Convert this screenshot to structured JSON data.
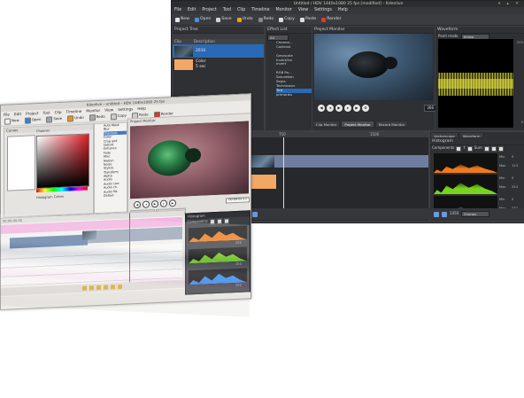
{
  "dark_window": {
    "title": "Untitled / HDV 1440x1080 25 fps [modified] – Kdenlive",
    "menu": [
      "File",
      "Edit",
      "Project",
      "Tool",
      "Clip",
      "Timeline",
      "Monitor",
      "View",
      "Settings",
      "Help"
    ],
    "toolbar": [
      {
        "label": "New",
        "icon": "new-document-icon",
        "color": "#e6e6e6"
      },
      {
        "label": "Open",
        "icon": "open-folder-icon",
        "color": "#4a8fd8"
      },
      {
        "label": "Save",
        "icon": "save-icon",
        "color": "#cfd3d8"
      },
      {
        "label": "Undo",
        "icon": "undo-icon",
        "color": "#f0a020"
      },
      {
        "label": "Redo",
        "icon": "redo-icon",
        "color": "#888888"
      },
      {
        "label": "Copy",
        "icon": "copy-icon",
        "color": "#dddddd"
      },
      {
        "label": "Paste",
        "icon": "paste-icon",
        "color": "#dddddd"
      },
      {
        "label": "Render",
        "icon": "render-icon",
        "color": "#e03a2a"
      }
    ],
    "project_tree": {
      "title": "Project Tree",
      "columns": [
        "Clip",
        "Description"
      ],
      "clips": [
        {
          "name": "2010",
          "sub": "",
          "selected": true,
          "thumb": "dark"
        },
        {
          "name": "Color",
          "sub": "5 sec",
          "selected": false,
          "thumb": "color"
        }
      ]
    },
    "effect_list": {
      "title": "Effect List",
      "filter": "All",
      "items": [
        "Chroma…",
        "Contrast",
        "",
        "Greyscale",
        "Invert/Inv",
        "Invert",
        "",
        "RGB Pa…",
        "Saturation",
        "Sepia",
        "Technicolor",
        "Tint",
        "primaries"
      ],
      "selected_index": 11
    },
    "monitor": {
      "title": "Project Monitor",
      "timecode": "366",
      "tabs": [
        "Clip Monitor",
        "Project Monitor",
        "Record Monitor"
      ],
      "active_tab": 1
    },
    "waveform": {
      "title": "Waveform",
      "mode_label": "Paint mode",
      "mode_value": "Yellow",
      "scale_top": "255",
      "scale_bottom": "0"
    },
    "timeline": {
      "ruler_marks": [
        "750",
        "1500"
      ]
    },
    "histogram": {
      "tabs": [
        "Vectorscope",
        "Waveform"
      ],
      "title": "Histogram",
      "components_label": "Components",
      "y_label": "Y",
      "sum_label": "Sum",
      "bands": [
        {
          "color": "#f07a1a",
          "min_label": "Min",
          "min": "0",
          "max_label": "Max",
          "max": "113"
        },
        {
          "color": "#77d41c",
          "min_label": "Min",
          "min": "0",
          "max_label": "Max",
          "max": "254"
        },
        {
          "color": "#2a8ef0",
          "min_label": "Min",
          "min": "0",
          "max_label": "Max",
          "max": "237"
        }
      ]
    },
    "bottom_right": {
      "frame_value": "1450",
      "zoom_label": "Frames"
    }
  },
  "light_window": {
    "title": "Kdenlive – untitled – HDV 1440x1080 25 fps",
    "menu": [
      "File",
      "Edit",
      "Project",
      "Tool",
      "Clip",
      "Timeline",
      "Monitor",
      "View",
      "Settings",
      "Help"
    ],
    "toolbar": [
      "New",
      "Open",
      "Save",
      "Undo",
      "Redo",
      "Copy",
      "Paste",
      "Render"
    ],
    "color_panel": {
      "title": "Curves",
      "channel_label": "Channel",
      "bottom_label": "Histogram Colors"
    },
    "effects": {
      "items": [
        "Auto Mask",
        "Blur",
        "Channels",
        "Color",
        "Crop and",
        "Distort",
        "Enhance",
        "Fade",
        "Misc",
        "Motion",
        "Noise",
        "Stylize",
        "Transform",
        "Alpha",
        "Audio",
        "Audio corr.",
        "Audio ch.",
        "Audio filt.",
        "Delays"
      ],
      "selected_index": 2
    },
    "monitor": {
      "title": "Project Monitor",
      "timecode": "00:00:02:11",
      "tabs": [
        "Clip Monitor",
        "Project Monitor"
      ]
    },
    "histogram": {
      "title": "Histogram",
      "components_label": "Components",
      "bands": [
        {
          "color": "#f07a1a",
          "max": "255"
        },
        {
          "color": "#77d41c",
          "max": "255"
        },
        {
          "color": "#2a8ef0",
          "max": "255"
        }
      ]
    },
    "timeline": {
      "ruler": "00:00:00:00"
    }
  }
}
